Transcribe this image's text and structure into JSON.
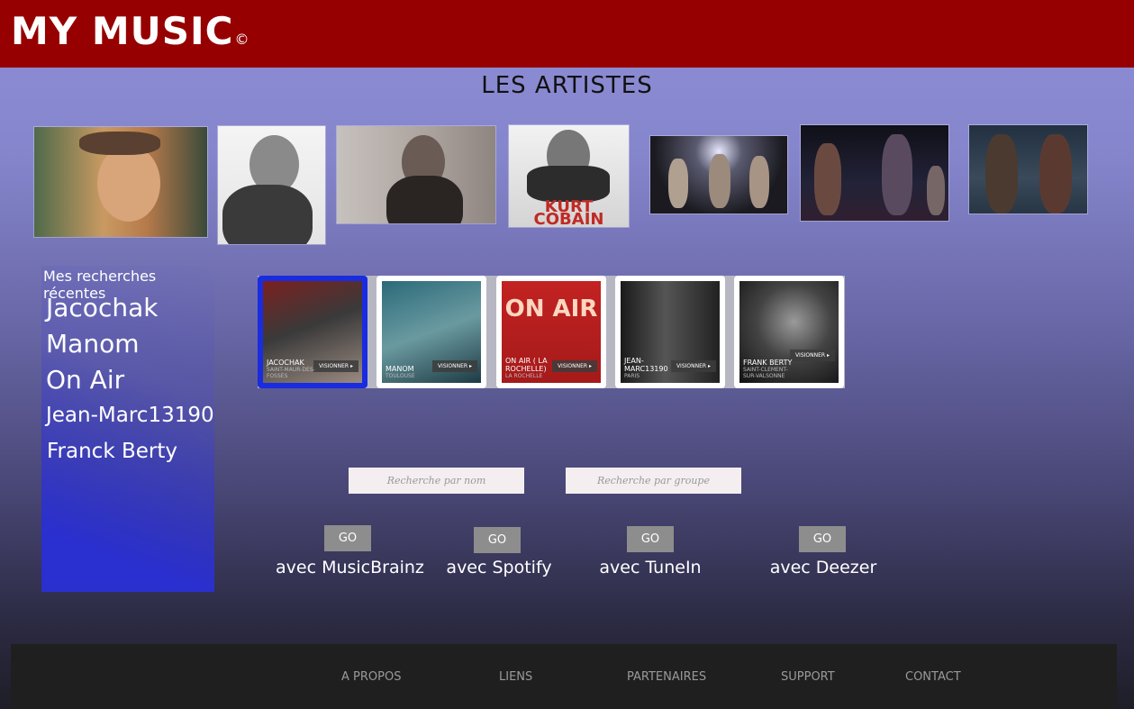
{
  "app": {
    "logo": "MY MUSIC",
    "logo_mark": "©"
  },
  "section": {
    "title": "LES ARTISTES"
  },
  "artist_images": [
    {
      "name": "artist-photo-1"
    },
    {
      "name": "artist-photo-2"
    },
    {
      "name": "artist-photo-3"
    },
    {
      "name": "artist-photo-kurt-cobain",
      "text": "KURT COBAIN"
    },
    {
      "name": "artist-photo-5"
    },
    {
      "name": "artist-photo-6"
    },
    {
      "name": "artist-photo-7"
    }
  ],
  "sidebar": {
    "title": "Mes recherches récentes",
    "items": [
      "Jacochak",
      "Manom",
      "On Air",
      "Jean-Marc13190",
      "Franck Berty"
    ]
  },
  "cards": [
    {
      "title": "JACOCHAK",
      "sub": "SAINT-MAUR-DES-FOSSÉS",
      "action": "VISIONNER"
    },
    {
      "title": "MANOM",
      "sub": "TOULOUSE",
      "action": "VISIONNER"
    },
    {
      "title": "ON AIR ( LA ROCHELLE)",
      "sub": "LA ROCHELLE",
      "action": "VISIONNER",
      "banner": "ON AIR"
    },
    {
      "title": "JEAN-MARC13190",
      "sub": "PARIS",
      "action": "VISIONNER"
    },
    {
      "title": "FRANK BERTY",
      "sub": "SAINT-CLEMENT-SUR-VALSONNE",
      "action": "VISIONNER"
    }
  ],
  "search": {
    "by_name_placeholder": "Recherche par nom",
    "by_group_placeholder": "Recherche par groupe"
  },
  "services": [
    {
      "button": "GO",
      "label": "avec MusicBrainz"
    },
    {
      "button": "GO",
      "label": "avec Spotify"
    },
    {
      "button": "GO",
      "label": "avec TuneIn"
    },
    {
      "button": "GO",
      "label": "avec Deezer"
    }
  ],
  "footer": {
    "links": [
      "A PROPOS",
      "LIENS",
      "PARTENAIRES",
      "SUPPORT",
      "CONTACT"
    ]
  },
  "colors": {
    "header": "#960000",
    "active_card": "#1a2ce0",
    "footer": "#1f1f1f"
  }
}
